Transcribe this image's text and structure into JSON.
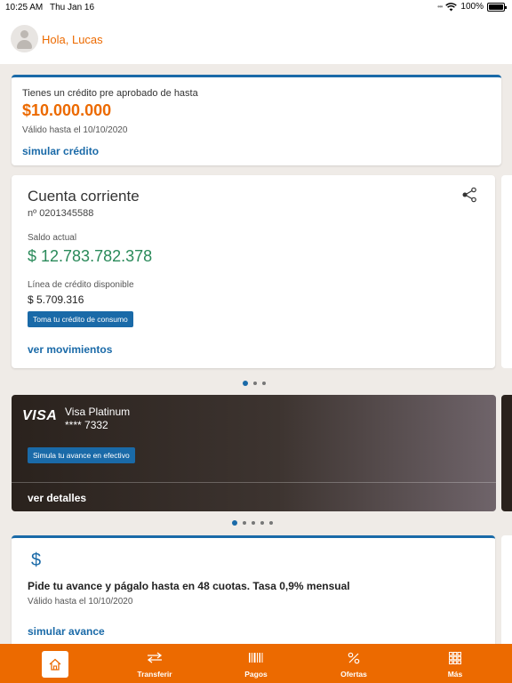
{
  "status": {
    "time": "10:25 AM",
    "date": "Thu Jan 16",
    "battery": "100%"
  },
  "header": {
    "greeting": "Hola, Lucas"
  },
  "promo": {
    "line1": "Tienes un crédito pre aprobado de hasta",
    "amount": "$10.000.000",
    "valid": "Válido hasta el 10/10/2020",
    "link": "simular crédito"
  },
  "account": {
    "title": "Cuenta corriente",
    "number": "nº 0201345588",
    "saldo_label": "Saldo actual",
    "saldo": "$ 12.783.782.378",
    "linea_label": "Línea de crédito disponible",
    "linea": "$ 5.709.316",
    "button": "Toma tu crédito de consumo",
    "link": "ver movimientos"
  },
  "card": {
    "brand": "VISA",
    "name": "Visa Platinum",
    "digits": "**** 7332",
    "button": "Simula tu avance en efectivo",
    "link": "ver detalles"
  },
  "advance": {
    "icon": "$",
    "text": "Pide tu avance y págalo hasta en 48 cuotas. Tasa 0,9% mensual",
    "valid": "Válido hasta el 10/10/2020",
    "link": "simular avance"
  },
  "tabs": {
    "transferir": "Transferir",
    "pagos": "Pagos",
    "ofertas": "Ofertas",
    "mas": "Más"
  },
  "colors": {
    "accent": "#ec6a00",
    "primary": "#1a6aa8",
    "positive": "#2a8a5a",
    "background": "#efebe7"
  }
}
